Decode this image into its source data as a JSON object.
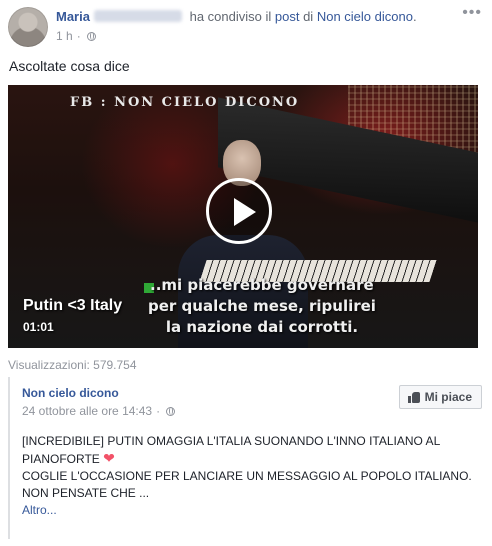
{
  "header": {
    "author": "Maria",
    "action_text": "ha condiviso il",
    "post_link": "post",
    "preposition": "di",
    "page_link": "Non cielo dicono",
    "period": ".",
    "time": "1 h",
    "separator": "·",
    "menu_icon": "ellipsis-icon",
    "privacy_icon": "globe-icon"
  },
  "message": "Ascoltate cosa dice",
  "video": {
    "watermark": "FB : NON CIELO DICONO",
    "title": "Putin <3 Italy",
    "duration": "01:01",
    "subtitle_lines": [
      "..mi piacerebbe governare",
      "per qualche mese, ripulirei",
      "la nazione dai corrotti."
    ],
    "play_icon": "play-icon"
  },
  "views": "Visualizzazioni: 579.754",
  "shared_post": {
    "page_name": "Non cielo dicono",
    "date": "24 ottobre alle ore 14:43",
    "separator": "·",
    "like_button": "Mi piace",
    "text_line1": "[INCREDIBILE] PUTIN OMAGGIA L'ITALIA SUONANDO L'INNO ITALIANO AL",
    "text_line2": "PIANOFORTE",
    "heart": "❤",
    "text_line3": "COGLIE L'OCCASIONE PER LANCIARE UN MESSAGGIO AL POPOLO ITALIANO.",
    "text_line4": "NON PENSATE CHE ...",
    "more": "Altro..."
  },
  "colors": {
    "link": "#365899",
    "meta": "#90949c",
    "heart": "#f25268"
  }
}
